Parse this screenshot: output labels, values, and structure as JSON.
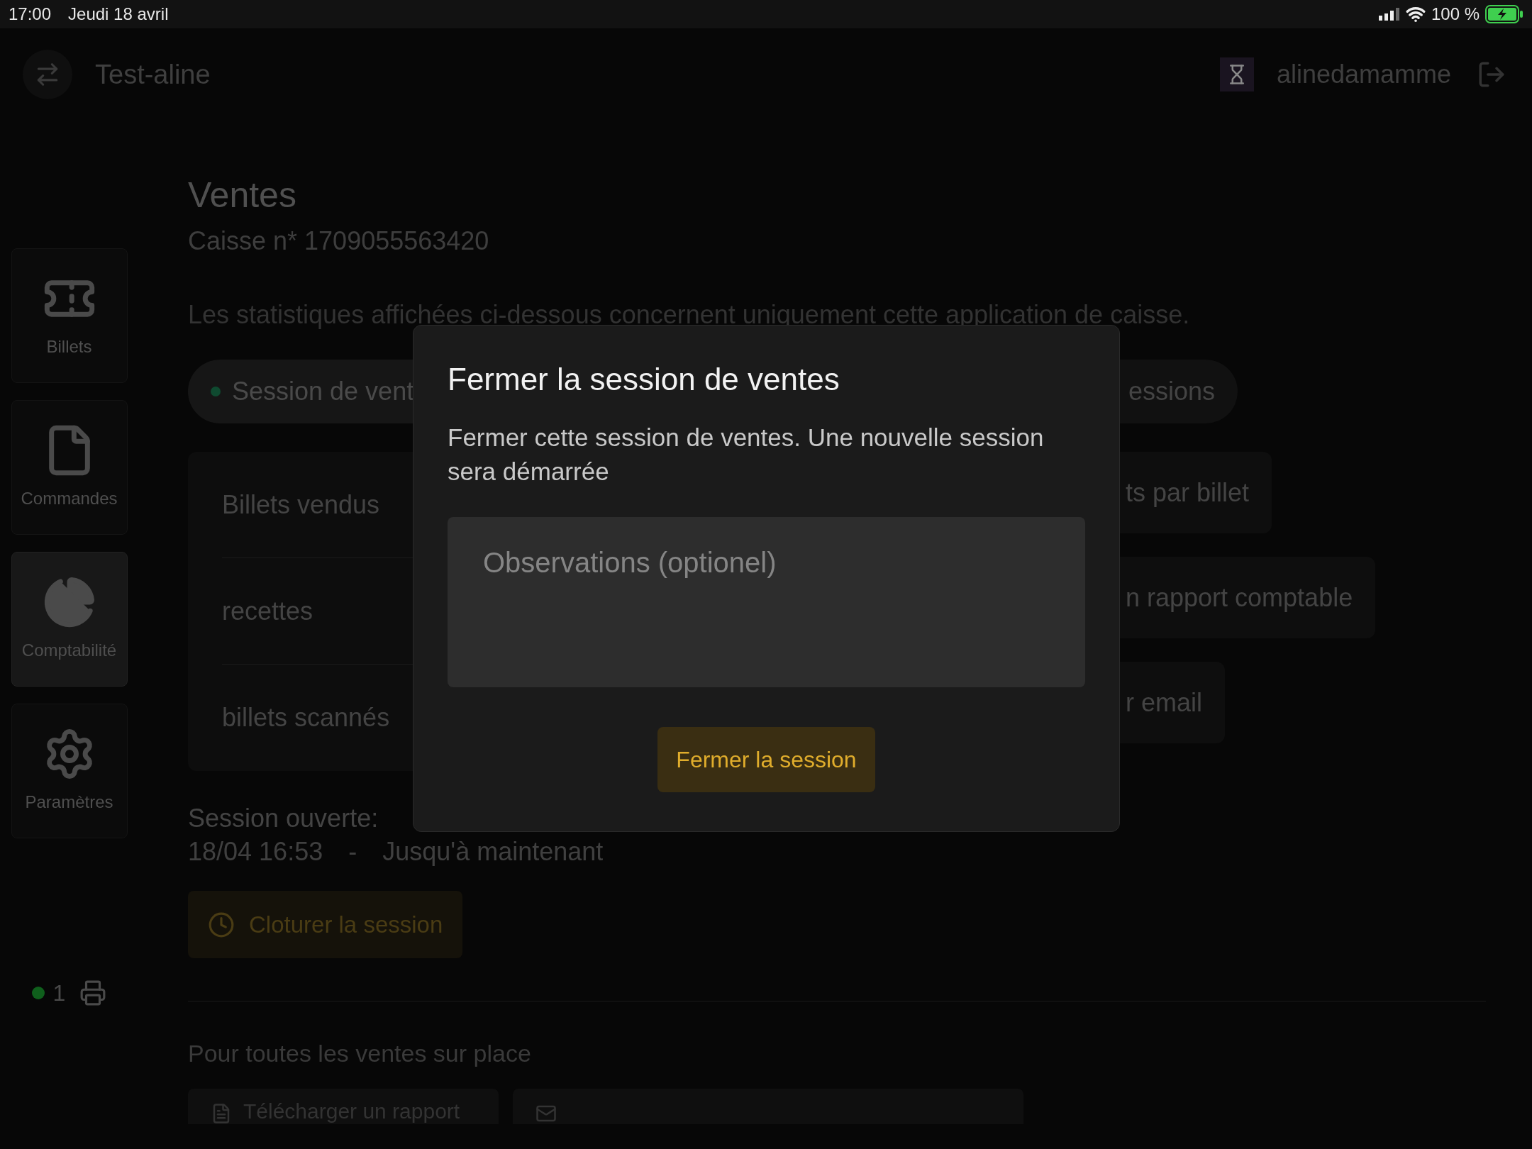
{
  "status_bar": {
    "time": "17:00",
    "date": "Jeudi 18 avril",
    "battery": "100 %"
  },
  "header": {
    "title": "Test-aline",
    "user": "alinedamamme"
  },
  "sidebar": {
    "items": [
      {
        "label": "Billets",
        "selected": false
      },
      {
        "label": "Commandes",
        "selected": false
      },
      {
        "label": "Comptabilité",
        "selected": true
      },
      {
        "label": "Paramètres",
        "selected": false
      }
    ],
    "printer": {
      "count": "1",
      "color": "#0f5f1c"
    }
  },
  "page": {
    "title": "Ventes",
    "subtitle": "Caisse n* 1709055563420",
    "description": "Les statistiques affichées ci-dessous concernent uniquement cette application de caisse.",
    "tabs": [
      {
        "label": "Session de vent",
        "selected": true
      },
      {
        "label": "essions",
        "selected": false
      }
    ],
    "stats": [
      "Billets vendus",
      "recettes",
      "billets scannés"
    ],
    "actions": [
      "ts par billet",
      "n rapport comptable",
      "r email"
    ],
    "session": {
      "label": "Session ouverte:",
      "start": "18/04 16:53",
      "separator": "-",
      "end": "Jusqu'à maintenant"
    },
    "close_button": "Cloturer la session",
    "section_title": "Pour toutes les ventes sur place",
    "reports": [
      {
        "kind": "download",
        "label": "Télécharger un rapport"
      },
      {
        "kind": "mail"
      }
    ]
  },
  "dialog": {
    "title": "Fermer la session de ventes",
    "message": "Fermer cette session de ventes. Une nouvelle session sera démarrée",
    "field": {
      "placeholder": "Observations (optionel)"
    },
    "button": "Fermer la session"
  }
}
